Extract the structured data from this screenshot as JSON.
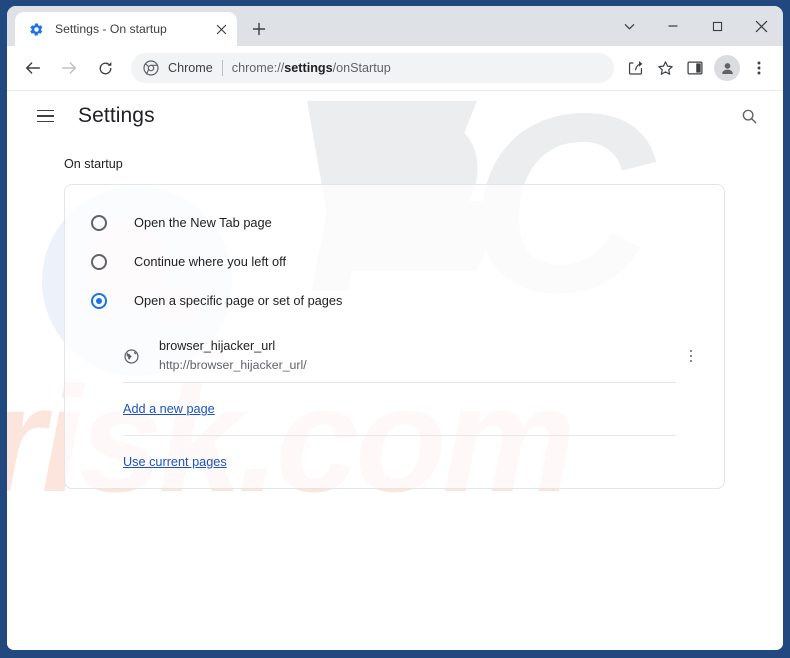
{
  "window": {
    "border_color": "#21497f",
    "controls": {
      "tab_search_label": "tab-search",
      "minimize_label": "minimize",
      "maximize_label": "maximize",
      "close_label": "close"
    }
  },
  "tab": {
    "title": "Settings - On startup",
    "favicon": "gear-icon",
    "close_label": "close-tab",
    "new_tab_label": "new-tab"
  },
  "toolbar": {
    "back_label": "back",
    "forward_label": "forward",
    "reload_label": "reload",
    "omnibox": {
      "chrome_icon": "chrome-icon",
      "source_label": "Chrome",
      "url_prefix": "chrome://",
      "url_bold": "settings",
      "url_suffix": "/onStartup"
    },
    "share_label": "share",
    "bookmark_label": "bookmark-star",
    "side_panel_label": "side-panel",
    "profile_label": "profile-avatar",
    "menu_label": "chrome-menu"
  },
  "settings": {
    "menu_label": "main-menu",
    "title": "Settings",
    "search_label": "search-settings"
  },
  "on_startup": {
    "section_title": "On startup",
    "options": [
      {
        "label": "Open the New Tab page",
        "selected": false
      },
      {
        "label": "Continue where you left off",
        "selected": false
      },
      {
        "label": "Open a specific page or set of pages",
        "selected": true
      }
    ],
    "startup_pages": [
      {
        "name": "browser_hijacker_url",
        "url": "http://browser_hijacker_url/",
        "icon": "globe-icon",
        "menu_label": "page-options"
      }
    ],
    "add_page_link": "Add a new page",
    "use_current_link": "Use current pages"
  },
  "watermark": {
    "text_top": "PC",
    "text_bottom": "risk.com",
    "color_gray": "#ebedee",
    "color_peach": "#fbe4dc",
    "circle_color": "#e8eef8"
  },
  "colors": {
    "accent": "#1a73e8",
    "link": "#1a52c4",
    "text_primary": "#202124",
    "text_secondary": "#5f6368",
    "tabstrip": "#dee1e6"
  }
}
